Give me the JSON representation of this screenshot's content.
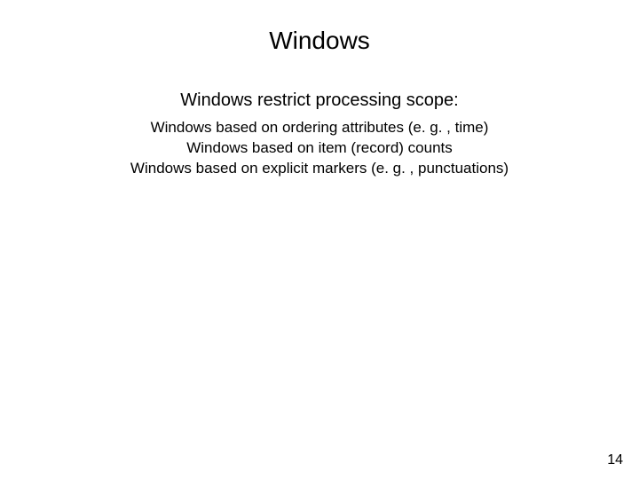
{
  "slide": {
    "title": "Windows",
    "subtitle": "Windows restrict processing scope:",
    "body_lines": {
      "0": "Windows based on ordering attributes (e. g. , time)",
      "1": "Windows based on item (record) counts",
      "2": "Windows based on explicit markers (e. g. , punctuations)"
    },
    "page_number": "14"
  }
}
